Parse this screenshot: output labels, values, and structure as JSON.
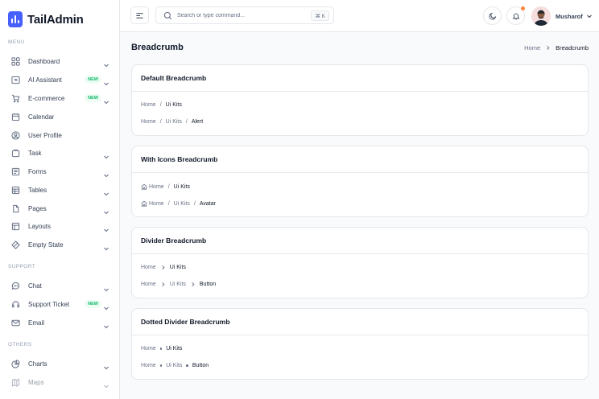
{
  "brand": {
    "name": "TailAdmin",
    "color": "#465fff"
  },
  "sidebar": {
    "sections": [
      {
        "label": "MENU"
      },
      {
        "label": "SUPPORT"
      },
      {
        "label": "OTHERS"
      }
    ],
    "items": [
      {
        "label": "Dashboard",
        "icon": "grid-icon",
        "chevron": true
      },
      {
        "label": "AI Assistant",
        "icon": "ai-sparkle-icon",
        "badge": "NEW",
        "chevron": true
      },
      {
        "label": "E-commerce",
        "icon": "cart-icon",
        "badge": "NEW",
        "chevron": true
      },
      {
        "label": "Calendar",
        "icon": "calendar-icon"
      },
      {
        "label": "User Profile",
        "icon": "user-circle-icon"
      },
      {
        "label": "Task",
        "icon": "task-icon",
        "chevron": true
      },
      {
        "label": "Forms",
        "icon": "forms-icon",
        "chevron": true
      },
      {
        "label": "Tables",
        "icon": "table-icon",
        "chevron": true
      },
      {
        "label": "Pages",
        "icon": "pages-icon",
        "chevron": true
      },
      {
        "label": "Layouts",
        "icon": "layouts-icon",
        "chevron": true
      },
      {
        "label": "Empty State",
        "icon": "empty-state-icon",
        "chevron": true
      },
      {
        "label": "Chat",
        "icon": "chat-icon",
        "chevron": true
      },
      {
        "label": "Support Ticket",
        "icon": "headset-icon",
        "badge": "NEW",
        "chevron": true
      },
      {
        "label": "Email",
        "icon": "mail-icon",
        "chevron": true
      },
      {
        "label": "Charts",
        "icon": "pie-chart-icon",
        "chevron": true
      },
      {
        "label": "Maps",
        "icon": "map-icon",
        "chevron": true
      }
    ]
  },
  "header": {
    "search": {
      "placeholder": "Search or type command...",
      "shortcut": "⌘ K"
    },
    "user": {
      "name": "Musharof"
    },
    "notification_dot_color": "#fd853a"
  },
  "page": {
    "title": "Breadcrumb",
    "breadcrumb": {
      "home": "Home",
      "current": "Breadcrumb"
    }
  },
  "cards": [
    {
      "title": "Default Breadcrumb",
      "separator": "/",
      "rows": [
        {
          "links": [
            "Home"
          ],
          "current": "Ui Kits"
        },
        {
          "links": [
            "Home",
            "Ui Kits"
          ],
          "current": "Alert"
        }
      ]
    },
    {
      "title": "With Icons Breadcrumb",
      "separator": "/",
      "rows": [
        {
          "links": [
            "Home"
          ],
          "current": "Ui Kits"
        },
        {
          "links": [
            "Home",
            "Ui Kits"
          ],
          "current": "Avatar"
        }
      ]
    },
    {
      "title": "Divider Breadcrumb",
      "rows": [
        {
          "links": [
            "Home"
          ],
          "current": "Ui Kits"
        },
        {
          "links": [
            "Home",
            "Ui Kits"
          ],
          "current": "Button"
        }
      ]
    },
    {
      "title": "Dotted Divider Breadcrumb",
      "rows": [
        {
          "links": [
            "Home"
          ],
          "current": "Ui Kits"
        },
        {
          "links": [
            "Home",
            "Ui Kits"
          ],
          "current": "Button"
        }
      ]
    }
  ]
}
